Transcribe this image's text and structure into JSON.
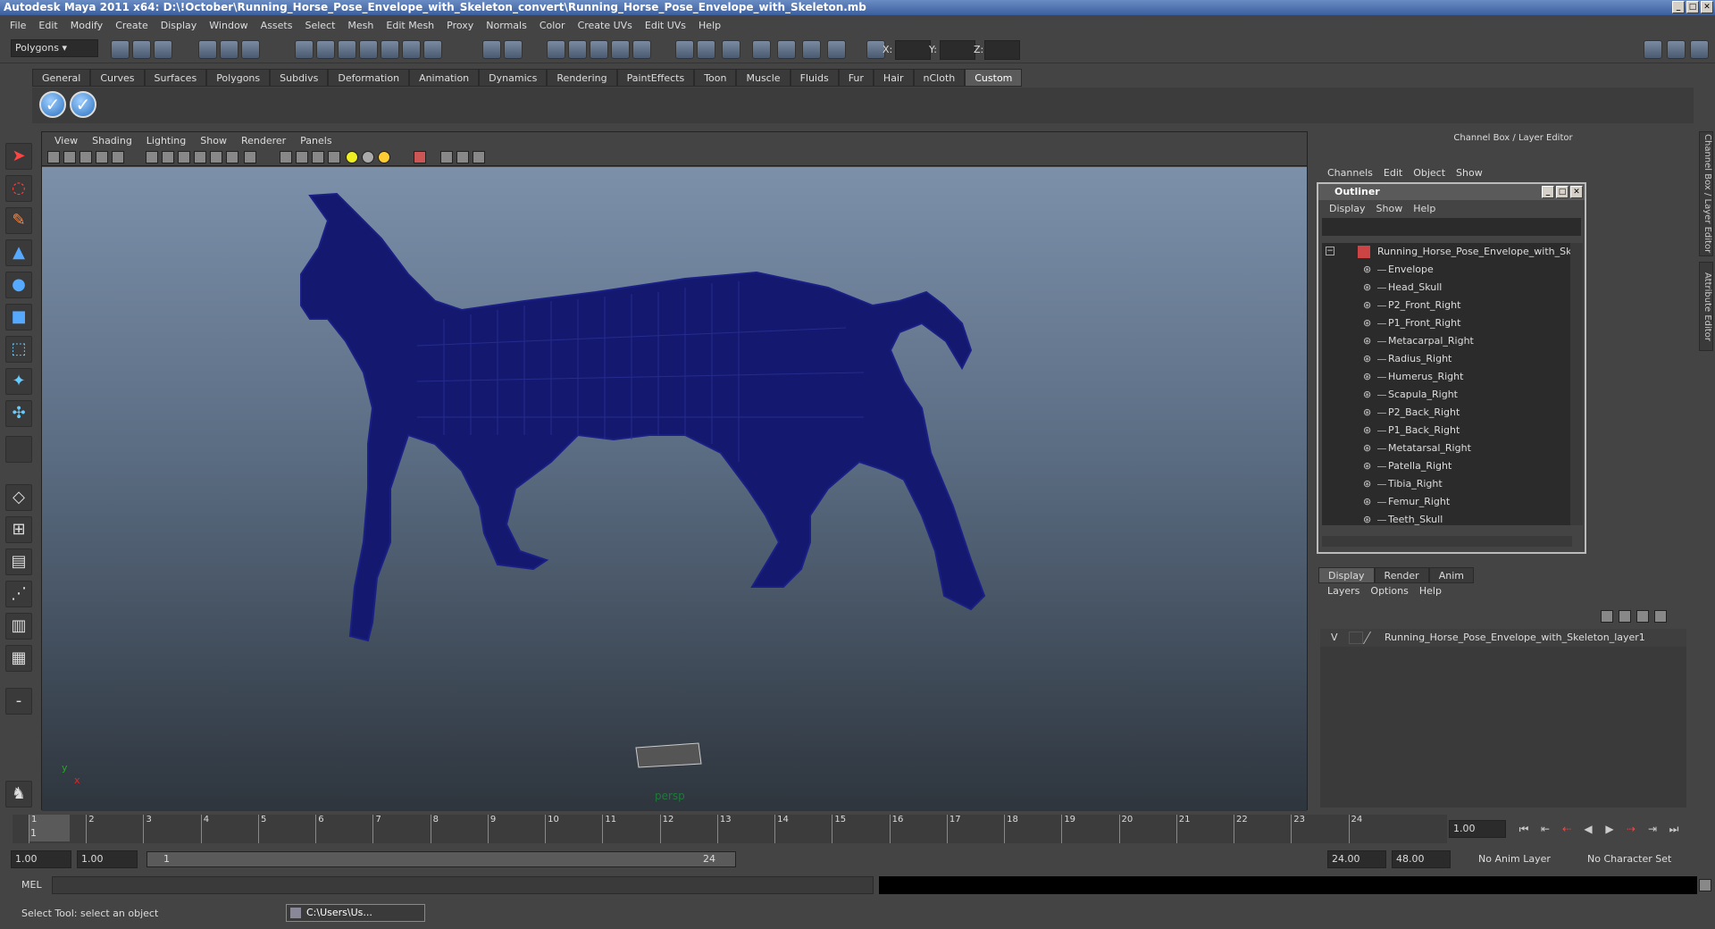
{
  "window": {
    "title": "Autodesk Maya 2011 x64: D:\\!October\\Running_Horse_Pose_Envelope_with_Skeleton_convert\\Running_Horse_Pose_Envelope_with_Skeleton.mb"
  },
  "menubar": [
    "File",
    "Edit",
    "Modify",
    "Create",
    "Display",
    "Window",
    "Assets",
    "Select",
    "Mesh",
    "Edit Mesh",
    "Proxy",
    "Normals",
    "Color",
    "Create UVs",
    "Edit UVs",
    "Help"
  ],
  "toolbar": {
    "mode": "Polygons",
    "x_label": "X:",
    "y_label": "Y:",
    "z_label": "Z:"
  },
  "shelf": {
    "tabs": [
      "General",
      "Curves",
      "Surfaces",
      "Polygons",
      "Subdivs",
      "Deformation",
      "Animation",
      "Dynamics",
      "Rendering",
      "PaintEffects",
      "Toon",
      "Muscle",
      "Fluids",
      "Fur",
      "Hair",
      "nCloth",
      "Custom"
    ],
    "active": "Custom"
  },
  "viewport": {
    "menu": [
      "View",
      "Shading",
      "Lighting",
      "Show",
      "Renderer",
      "Panels"
    ],
    "camera": "persp",
    "axis_x": "x",
    "axis_y": "y"
  },
  "channelbox": {
    "title": "Channel Box / Layer Editor",
    "menu": [
      "Channels",
      "Edit",
      "Object",
      "Show"
    ]
  },
  "outliner": {
    "title": "Outliner",
    "menu": [
      "Display",
      "Show",
      "Help"
    ],
    "root": "Running_Horse_Pose_Envelope_with_Ske",
    "items": [
      "Envelope",
      "Head_Skull",
      "P2_Front_Right",
      "P1_Front_Right",
      "Metacarpal_Right",
      "Radius_Right",
      "Humerus_Right",
      "Scapula_Right",
      "P2_Back_Right",
      "P1_Back_Right",
      "Metatarsal_Right",
      "Patella_Right",
      "Tibia_Right",
      "Femur_Right",
      "Teeth_Skull"
    ]
  },
  "layers": {
    "tabs": [
      "Display",
      "Render",
      "Anim"
    ],
    "active": "Display",
    "menu": [
      "Layers",
      "Options",
      "Help"
    ],
    "layer_v": "V",
    "layer_name": "Running_Horse_Pose_Envelope_with_Skeleton_layer1"
  },
  "sidebar_tabs": [
    "Channel Box / Layer Editor",
    "Attribute Editor"
  ],
  "timeline": {
    "ticks": [
      "1",
      "2",
      "3",
      "4",
      "5",
      "6",
      "7",
      "8",
      "9",
      "10",
      "11",
      "12",
      "13",
      "14",
      "15",
      "16",
      "17",
      "18",
      "19",
      "20",
      "21",
      "22",
      "23",
      "24"
    ],
    "current_frame": "1",
    "current_time": "1.00"
  },
  "range": {
    "start": "1.00",
    "anim_start": "1.00",
    "slider_start": "1",
    "slider_end": "24",
    "anim_end": "24.00",
    "end": "48.00",
    "anim_layer": "No Anim Layer",
    "char_set": "No Character Set"
  },
  "cmd": {
    "label": "MEL"
  },
  "status": {
    "help": "Select Tool: select an object",
    "task_label": "C:\\Users\\Us..."
  }
}
